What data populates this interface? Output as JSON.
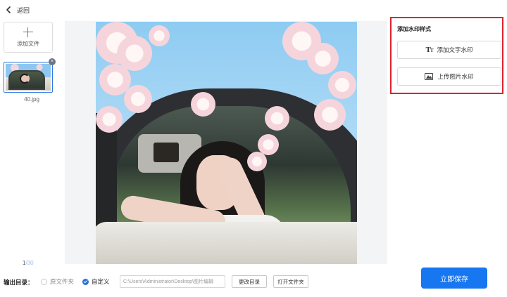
{
  "header": {
    "back_label": "返回"
  },
  "sidebar": {
    "add_file_label": "添加文件",
    "files": [
      {
        "name": "40.jpg",
        "selected": true
      }
    ],
    "page_current": "1",
    "page_total": "/30"
  },
  "watermark_panel": {
    "title": "添加水印样式",
    "add_text_label": "添加文字水印",
    "upload_image_label": "上传图片水印",
    "highlight_color": "#e0232d"
  },
  "output": {
    "label": "输出目录：",
    "options": [
      {
        "label": "原文件夹",
        "selected": false
      },
      {
        "label": "自定义",
        "selected": true
      }
    ],
    "path_value": "C:\\Users\\Administrator\\Desktop\\图片编辑",
    "change_dir_label": "更改目录",
    "open_folder_label": "打开文件夹"
  },
  "actions": {
    "save_label": "立即保存",
    "accent_color": "#1677f0"
  }
}
